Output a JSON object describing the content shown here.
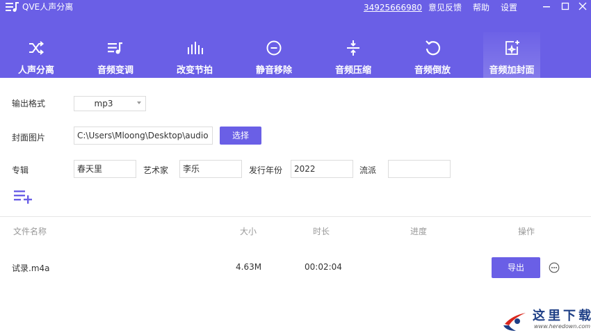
{
  "app": {
    "title": "QVE人声分离"
  },
  "titlebar": {
    "phone": "34925666980",
    "feedback": "意见反馈",
    "help": "帮助",
    "settings": "设置"
  },
  "tabs": [
    {
      "label": "人声分离",
      "icon": "shuffle-icon"
    },
    {
      "label": "音频变调",
      "icon": "music-list-icon"
    },
    {
      "label": "改变节拍",
      "icon": "rhythm-bars-icon"
    },
    {
      "label": "静音移除",
      "icon": "minus-circle-icon"
    },
    {
      "label": "音频压缩",
      "icon": "compress-icon"
    },
    {
      "label": "音频倒放",
      "icon": "reverse-icon"
    },
    {
      "label": "音频加封面",
      "icon": "add-cover-icon",
      "active": true
    }
  ],
  "form": {
    "format_label": "输出格式",
    "format_value": "mp3",
    "cover_label": "封面图片",
    "cover_path": "C:\\Users\\Mloong\\Desktop\\audio",
    "choose_label": "选择",
    "album_label": "专辑",
    "album_value": "春天里",
    "artist_label": "艺术家",
    "artist_value": "李乐",
    "year_label": "发行年份",
    "year_value": "2022",
    "genre_label": "流派",
    "genre_value": ""
  },
  "table": {
    "columns": [
      "文件名称",
      "大小",
      "时长",
      "进度",
      "操作"
    ],
    "rows": [
      {
        "name": "试录.m4a",
        "size": "4.63M",
        "duration": "00:02:04",
        "progress": "",
        "action": "导出"
      }
    ]
  },
  "watermark": {
    "title": "这里下载",
    "url": "www.heredown.com"
  },
  "colors": {
    "accent": "#6a5fe6",
    "brand_blue": "#1e3f86",
    "brand_red": "#d9261c"
  }
}
